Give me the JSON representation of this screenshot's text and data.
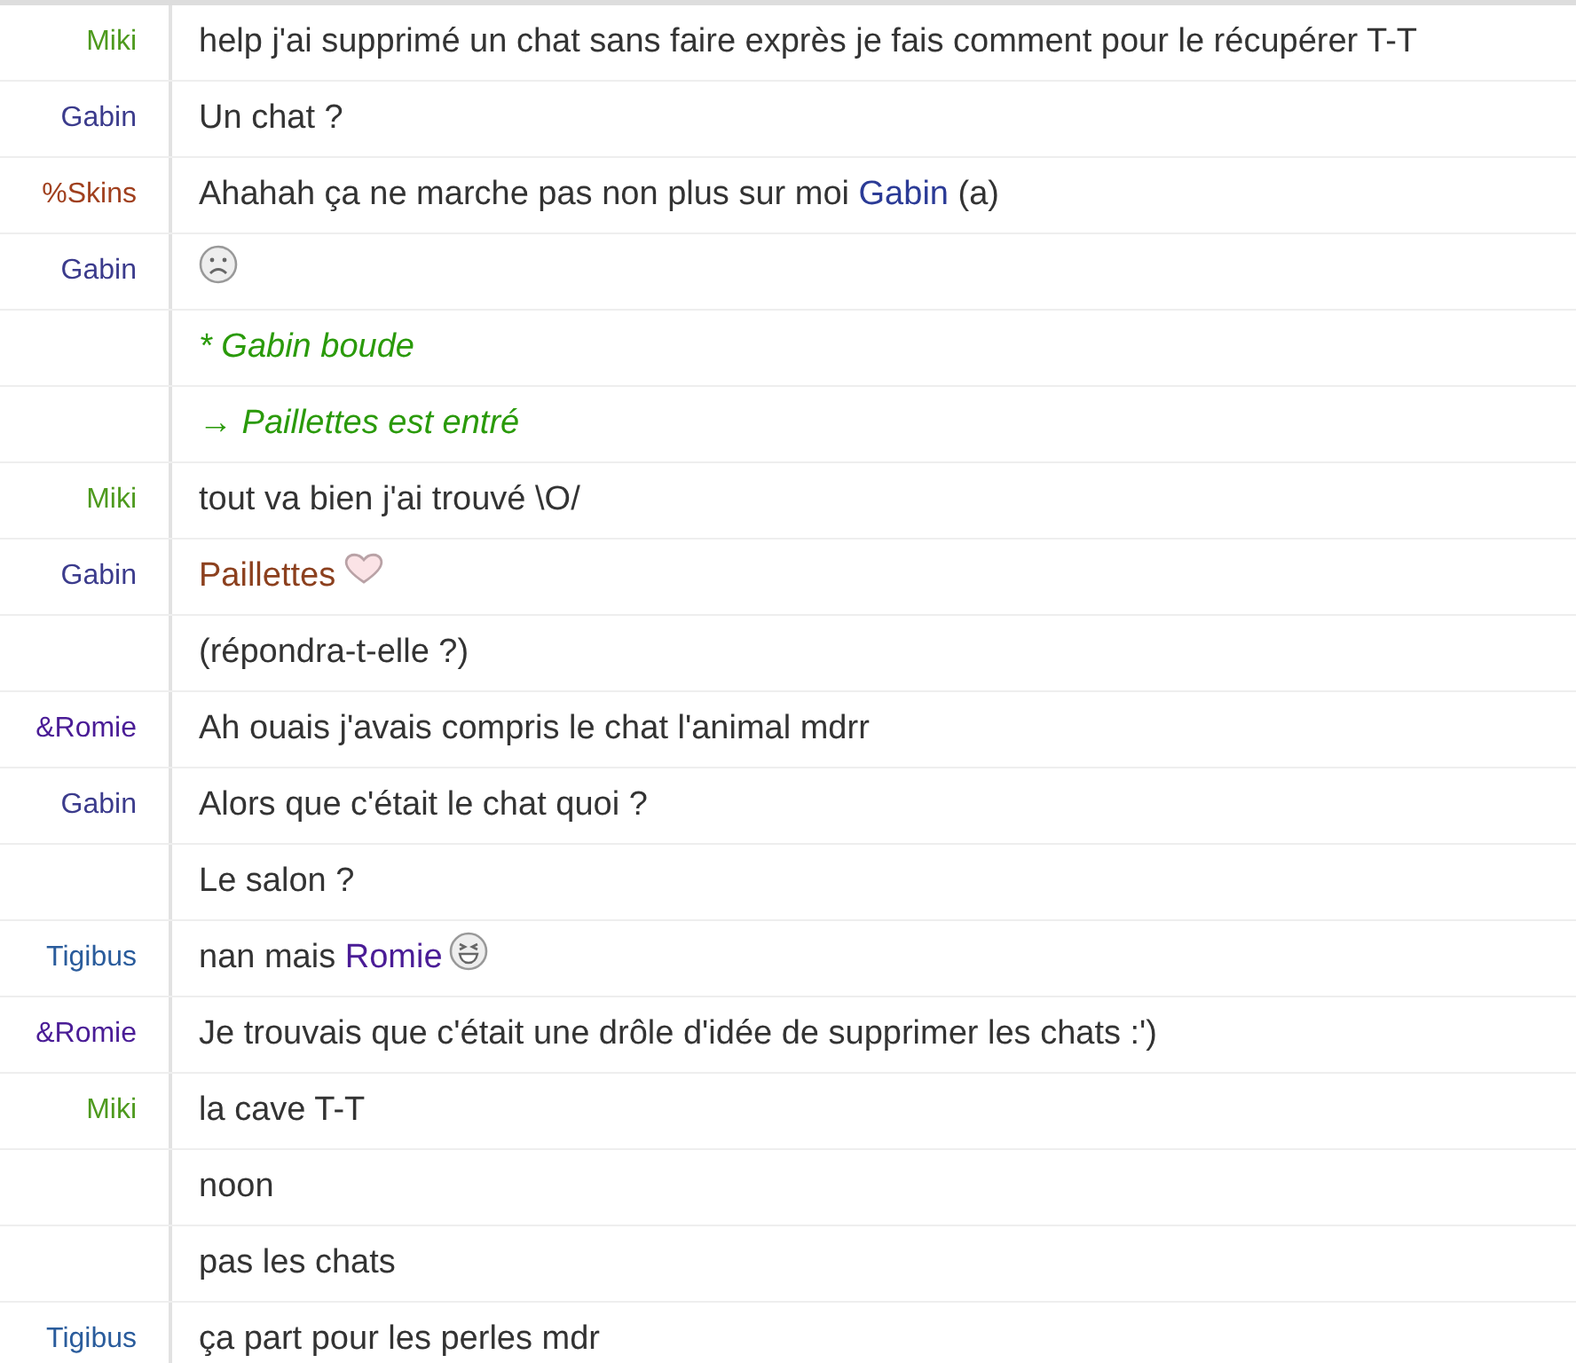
{
  "messages": [
    {
      "kind": "message",
      "nick": "Miki",
      "color": "#4e9a1e",
      "parts": [
        {
          "kind": "text",
          "text": "help j'ai supprimé un chat sans faire exprès je fais comment pour le récupérer T-T"
        }
      ]
    },
    {
      "kind": "message",
      "nick": "Gabin",
      "color": "#3b3b8c",
      "parts": [
        {
          "kind": "text",
          "text": "Un chat ?"
        }
      ]
    },
    {
      "kind": "message",
      "nick": "%Skins",
      "color": "#a0401e",
      "parts": [
        {
          "kind": "text",
          "text": "Ahahah ça ne marche pas non plus sur moi "
        },
        {
          "kind": "mention",
          "text": "Gabin",
          "color": "#2b3b96"
        },
        {
          "kind": "text",
          "text": " (a)"
        }
      ]
    },
    {
      "kind": "message",
      "nick": "Gabin",
      "color": "#3b3b8c",
      "parts": [
        {
          "kind": "sad"
        }
      ]
    },
    {
      "kind": "action",
      "parts": [
        {
          "kind": "text",
          "text": "* Gabin boude"
        }
      ]
    },
    {
      "kind": "action",
      "parts": [
        {
          "kind": "text",
          "text": "→ Paillettes est entré"
        }
      ]
    },
    {
      "kind": "message",
      "nick": "Miki",
      "color": "#4e9a1e",
      "parts": [
        {
          "kind": "text",
          "text": "tout va bien j'ai trouvé \\O/"
        }
      ]
    },
    {
      "kind": "message",
      "nick": "Gabin",
      "color": "#3b3b8c",
      "parts": [
        {
          "kind": "mention",
          "text": "Paillettes",
          "color": "#8c401e"
        },
        {
          "kind": "heart"
        }
      ]
    },
    {
      "kind": "message",
      "parts": [
        {
          "kind": "text",
          "text": "(répondra-t-elle ?)"
        }
      ]
    },
    {
      "kind": "message",
      "nick": "&Romie",
      "color": "#4a1c96",
      "parts": [
        {
          "kind": "text",
          "text": "Ah ouais j'avais compris le chat l'animal mdrr"
        }
      ]
    },
    {
      "kind": "message",
      "nick": "Gabin",
      "color": "#3b3b8c",
      "parts": [
        {
          "kind": "text",
          "text": "Alors que c'était le chat quoi ?"
        }
      ]
    },
    {
      "kind": "message",
      "parts": [
        {
          "kind": "text",
          "text": "Le salon ?"
        }
      ]
    },
    {
      "kind": "message",
      "nick": "Tigibus",
      "color": "#2a5c9c",
      "parts": [
        {
          "kind": "text",
          "text": "nan mais "
        },
        {
          "kind": "mention",
          "text": "Romie",
          "color": "#4a1c96"
        },
        {
          "kind": "grin"
        }
      ]
    },
    {
      "kind": "message",
      "nick": "&Romie",
      "color": "#4a1c96",
      "parts": [
        {
          "kind": "text",
          "text": "Je trouvais que c'était une drôle d'idée de supprimer les chats :')"
        }
      ]
    },
    {
      "kind": "message",
      "nick": "Miki",
      "color": "#4e9a1e",
      "parts": [
        {
          "kind": "text",
          "text": "la cave T-T"
        }
      ]
    },
    {
      "kind": "message",
      "parts": [
        {
          "kind": "text",
          "text": "noon"
        }
      ]
    },
    {
      "kind": "message",
      "parts": [
        {
          "kind": "text",
          "text": "pas les chats"
        }
      ]
    },
    {
      "kind": "message",
      "nick": "Tigibus",
      "color": "#2a5c9c",
      "parts": [
        {
          "kind": "text",
          "text": "ça part pour les perles mdr"
        }
      ]
    }
  ]
}
